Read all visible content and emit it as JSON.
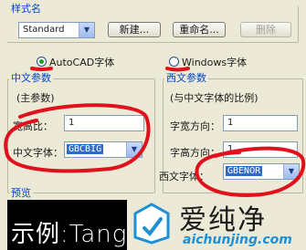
{
  "style_group": {
    "title": "样式名",
    "selected_style": "Standard",
    "buttons": {
      "new": "新建...",
      "rename": "重命名...",
      "delete": "删除"
    }
  },
  "font_mode": {
    "autocad_label": "AutoCAD字体",
    "windows_label": "Windows字体",
    "selected": "AutoCAD字体"
  },
  "chinese_params": {
    "title": "中文参数",
    "subtitle": "(主参数)",
    "width_ratio_label": "宽高比：",
    "width_ratio_value": "1",
    "font_label": "中文字体：",
    "font_value": "GBCBIG"
  },
  "western_params": {
    "title": "西文参数",
    "subtitle": "(与中文字体的比例)",
    "char_width_label": "字宽方向：",
    "char_width_value": "1",
    "char_height_label": "字高方向：",
    "char_height_value": "1",
    "font_label": "西文字体：",
    "font_value": "GBENOR"
  },
  "preview": {
    "title": "预览",
    "sample_text": "示例:Tang"
  },
  "watermark": {
    "brand": "爱纯净",
    "url": "aichunjing.com"
  },
  "colors": {
    "group_title": "#0047c8",
    "annotation_red": "#e0101c",
    "watermark_blue": "#1d90d6"
  }
}
